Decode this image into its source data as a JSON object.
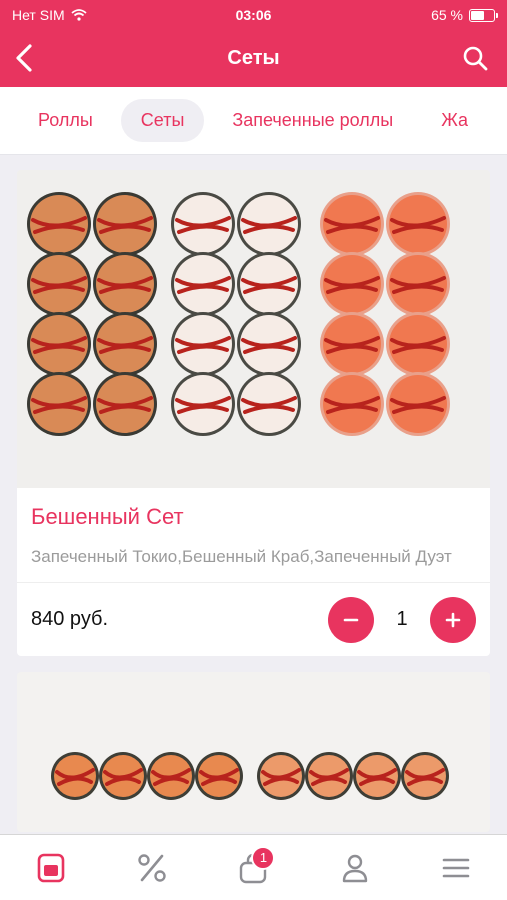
{
  "status_bar": {
    "carrier": "Нет SIM",
    "time": "03:06",
    "battery_text": "65 %",
    "battery_level": 0.65
  },
  "header": {
    "title": "Сеты",
    "back_icon": "chevron-left-icon",
    "search_icon": "search-icon",
    "color": "#e8345f"
  },
  "categories": [
    {
      "label": "Роллы",
      "active": false
    },
    {
      "label": "Сеты",
      "active": true
    },
    {
      "label": "Запеченные роллы",
      "active": false
    },
    {
      "label": "Жа",
      "active": false
    }
  ],
  "products": [
    {
      "title": "Бешенный Сет",
      "description": "Запеченный Токио,Бешенный Краб,Запеченный Дуэт",
      "price": "840 руб.",
      "quantity": "1",
      "image": "sushi-set-photo"
    }
  ],
  "tabbar": {
    "items": [
      {
        "icon": "menu-book-icon",
        "active": true
      },
      {
        "icon": "percent-icon",
        "active": false
      },
      {
        "icon": "cart-icon",
        "active": false,
        "badge": "1"
      },
      {
        "icon": "profile-icon",
        "active": false
      },
      {
        "icon": "hamburger-icon",
        "active": false
      }
    ]
  }
}
